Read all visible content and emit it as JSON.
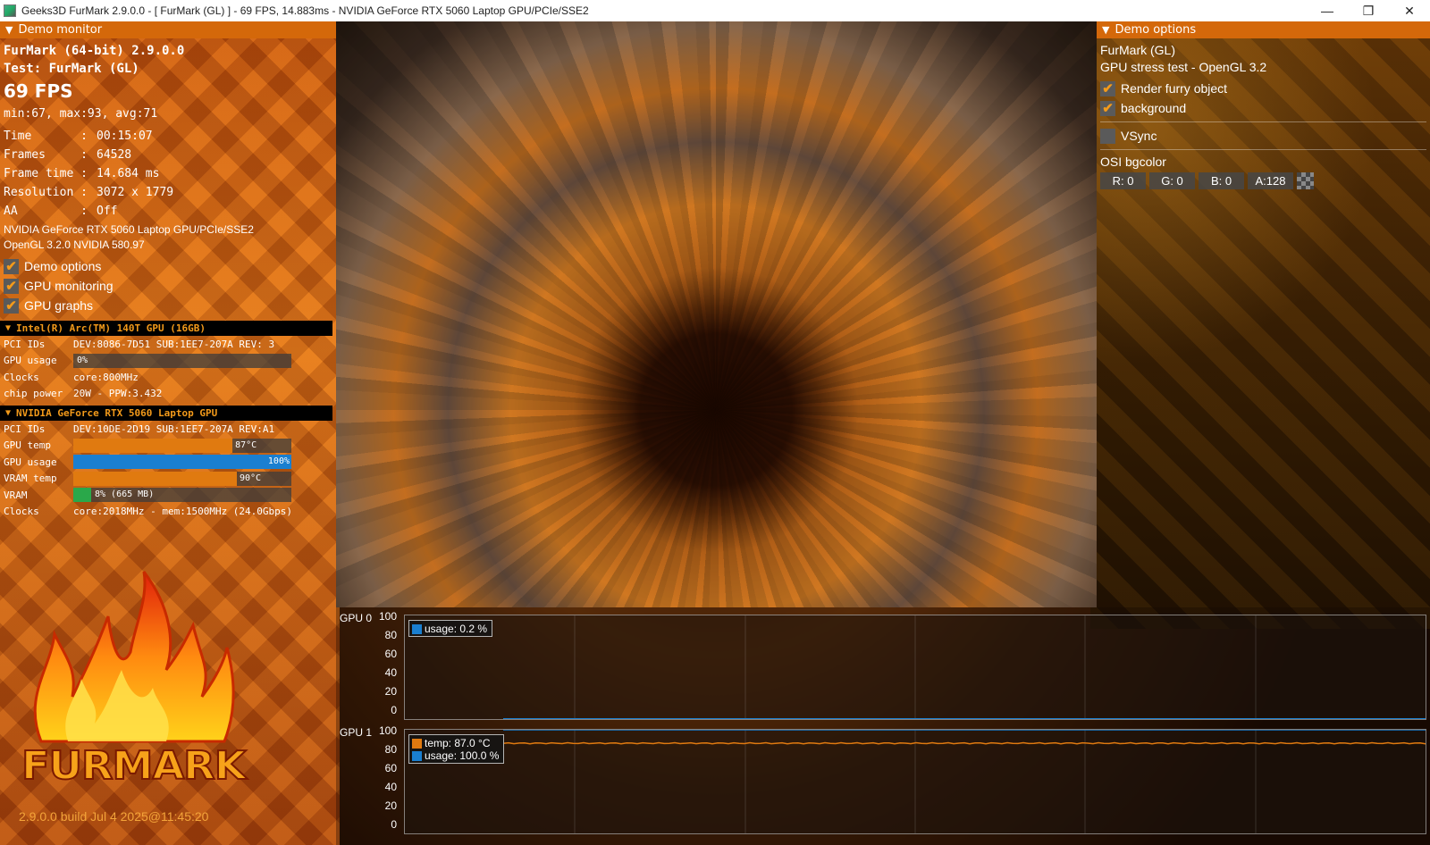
{
  "window": {
    "title": "Geeks3D FurMark 2.9.0.0 - [ FurMark (GL) ] - 69 FPS, 14.883ms - NVIDIA GeForce RTX 5060 Laptop GPU/PCIe/SSE2",
    "minimize": "—",
    "maximize": "❐",
    "close": "✕"
  },
  "demo_monitor": {
    "header": "Demo monitor",
    "app_line": "FurMark (64-bit) 2.9.0.0",
    "test_line": "Test: FurMark (GL)",
    "fps": "69 FPS",
    "minmax": "min:67, max:93, avg:71",
    "stats": [
      {
        "k": "Time       :",
        "v": "00:15:07"
      },
      {
        "k": "Frames     :",
        "v": "64528"
      },
      {
        "k": "Frame time :",
        "v": "14.684 ms"
      },
      {
        "k": "Resolution :",
        "v": "3072 x 1779"
      },
      {
        "k": "AA         :",
        "v": "Off"
      }
    ],
    "gpu_name": "NVIDIA GeForce RTX 5060 Laptop GPU/PCIe/SSE2",
    "gl_version": "OpenGL 3.2.0 NVIDIA 580.97",
    "checks": [
      {
        "label": "Demo options",
        "checked": "✔"
      },
      {
        "label": "GPU monitoring",
        "checked": "✔"
      },
      {
        "label": "GPU graphs",
        "checked": "✔"
      }
    ]
  },
  "gpu0": {
    "header": "Intel(R) Arc(TM) 140T GPU (16GB)",
    "pci_label": "PCI IDs",
    "pci_value": "DEV:8086-7D51 SUB:1EE7-207A REV: 3",
    "usage_label": "GPU usage",
    "usage_text": "0%",
    "usage_pct": 0,
    "clocks_label": "Clocks",
    "clocks_value": "core:800MHz",
    "power_label": "chip power",
    "power_value": "20W - PPW:3.432"
  },
  "gpu1": {
    "header": "NVIDIA GeForce RTX 5060 Laptop GPU",
    "pci_label": "PCI IDs",
    "pci_value": "DEV:10DE-2D19 SUB:1EE7-207A REV:A1",
    "temp_label": "GPU temp",
    "temp_text": "87°C",
    "temp_pct": 73,
    "usage_label": "GPU usage",
    "usage_text": "100%",
    "usage_pct": 100,
    "vram_temp_label": "VRAM temp",
    "vram_temp_text": "90°C",
    "vram_temp_pct": 75,
    "vram_label": "VRAM",
    "vram_text": "8% (665 MB)",
    "vram_pct": 8,
    "clocks_label": "Clocks",
    "clocks_value": "core:2018MHz - mem:1500MHz (24.0Gbps)"
  },
  "logo": {
    "text": "FURMARK",
    "build": "2.9.0.0 build Jul  4 2025@11:45:20"
  },
  "demo_options": {
    "header": "Demo options",
    "line1": "FurMark (GL)",
    "line2": "GPU stress test - OpenGL 3.2",
    "checks": [
      {
        "label": "Render furry object",
        "checked": "✔"
      },
      {
        "label": "background",
        "checked": "✔"
      }
    ],
    "vsync_label": "VSync",
    "osi_label": "OSI bgcolor",
    "r": "R: 0",
    "g": "G: 0",
    "b": "B: 0",
    "a": "A:128"
  },
  "graphs": {
    "gpu0_label": "GPU 0",
    "gpu1_label": "GPU 1",
    "yticks": [
      "100",
      "80",
      "60",
      "40",
      "20",
      "0"
    ],
    "gpu0_legend": [
      {
        "name": "usage: 0.2 %",
        "color": "#1a7fd0"
      }
    ],
    "gpu1_legend": [
      {
        "name": "temp: 87.0 °C",
        "color": "#e07a10"
      },
      {
        "name": "usage: 100.0 %",
        "color": "#1a7fd0"
      }
    ],
    "gpu0_usage": 0.2,
    "gpu1_temp": 87.0,
    "gpu1_usage": 100.0
  },
  "colors": {
    "accent": "#d4680a",
    "check": "#f39a1a",
    "temp": "#e07a10",
    "usage": "#1a7fd0",
    "vram": "#2aa84a"
  }
}
